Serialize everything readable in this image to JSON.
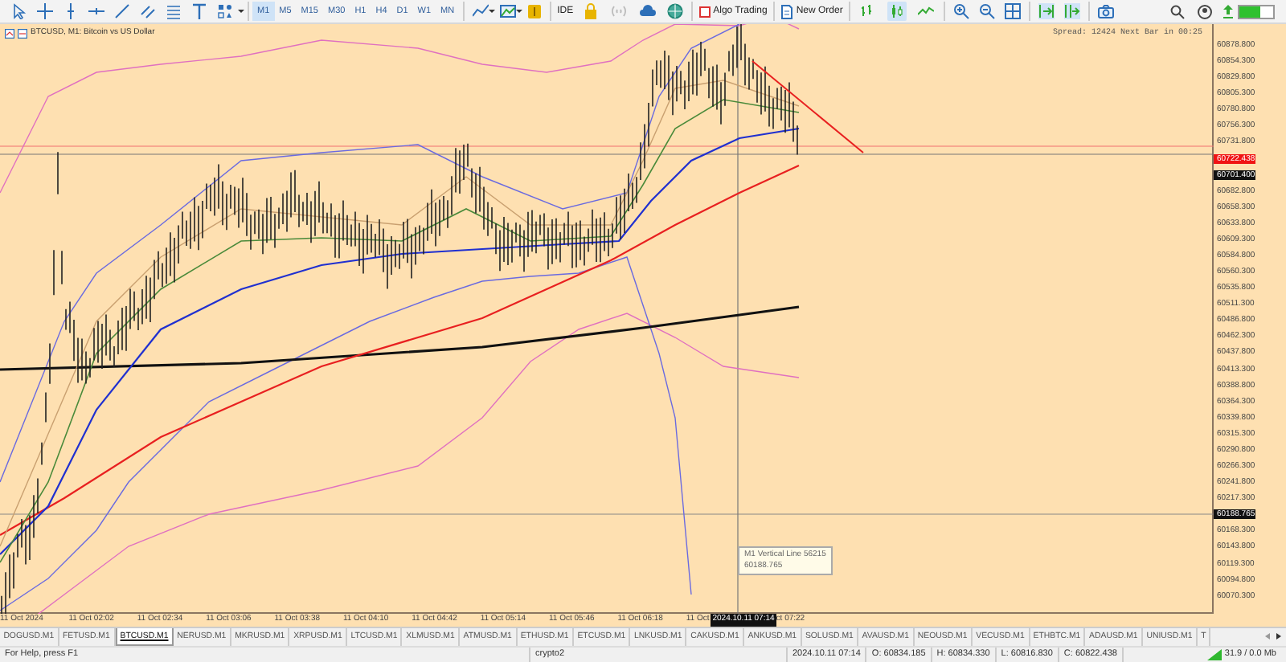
{
  "toolbar": {
    "timeframes": [
      {
        "label": "M1",
        "selected": true
      },
      {
        "label": "M5",
        "selected": false
      },
      {
        "label": "M15",
        "selected": false
      },
      {
        "label": "M30",
        "selected": false
      },
      {
        "label": "H1",
        "selected": false
      },
      {
        "label": "H4",
        "selected": false
      },
      {
        "label": "D1",
        "selected": false
      },
      {
        "label": "W1",
        "selected": false
      },
      {
        "label": "MN",
        "selected": false
      }
    ],
    "ide": "IDE",
    "algo_trading": "Algo Trading",
    "new_order": "New Order",
    "chart_modes": [
      {
        "kind": "bars",
        "selected": false
      },
      {
        "kind": "candles",
        "selected": true
      },
      {
        "kind": "line",
        "selected": false
      }
    ]
  },
  "chart": {
    "title": "BTCUSD, M1:  Bitcoin vs US Dollar",
    "spread_info": "Spread: 12424 Next Bar in 00:25",
    "tooltip": [
      "M1 Vertical Line 56215",
      "60188.765"
    ],
    "price_axis": [
      {
        "label": "60878.800",
        "kind": "tick"
      },
      {
        "label": "60854.300",
        "kind": "tick"
      },
      {
        "label": "60829.800",
        "kind": "tick"
      },
      {
        "label": "60805.300",
        "kind": "tick"
      },
      {
        "label": "60780.800",
        "kind": "tick"
      },
      {
        "label": "60756.300",
        "kind": "tick"
      },
      {
        "label": "60731.800",
        "kind": "tick"
      },
      {
        "label": "60722.438",
        "kind": "bid"
      },
      {
        "label": "60701.400",
        "kind": "marker"
      },
      {
        "label": "60682.800",
        "kind": "tick"
      },
      {
        "label": "60658.300",
        "kind": "tick"
      },
      {
        "label": "60633.800",
        "kind": "tick"
      },
      {
        "label": "60609.300",
        "kind": "tick"
      },
      {
        "label": "60584.800",
        "kind": "tick"
      },
      {
        "label": "60560.300",
        "kind": "tick"
      },
      {
        "label": "60535.800",
        "kind": "tick"
      },
      {
        "label": "60511.300",
        "kind": "tick"
      },
      {
        "label": "60486.800",
        "kind": "tick"
      },
      {
        "label": "60462.300",
        "kind": "tick"
      },
      {
        "label": "60437.800",
        "kind": "tick"
      },
      {
        "label": "60413.300",
        "kind": "tick"
      },
      {
        "label": "60388.800",
        "kind": "tick"
      },
      {
        "label": "60364.300",
        "kind": "tick"
      },
      {
        "label": "60339.800",
        "kind": "tick"
      },
      {
        "label": "60315.300",
        "kind": "tick"
      },
      {
        "label": "60290.800",
        "kind": "tick"
      },
      {
        "label": "60266.300",
        "kind": "tick"
      },
      {
        "label": "60241.800",
        "kind": "tick"
      },
      {
        "label": "60217.300",
        "kind": "tick"
      },
      {
        "label": "60188.765",
        "kind": "marker"
      },
      {
        "label": "60168.300",
        "kind": "tick"
      },
      {
        "label": "60143.800",
        "kind": "tick"
      },
      {
        "label": "60119.300",
        "kind": "tick"
      },
      {
        "label": "60094.800",
        "kind": "tick"
      },
      {
        "label": "60070.300",
        "kind": "tick"
      }
    ],
    "time_axis": [
      {
        "label": "11 Oct 2024",
        "kind": "tick"
      },
      {
        "label": "11 Oct 02:02",
        "kind": "tick"
      },
      {
        "label": "11 Oct 02:34",
        "kind": "tick"
      },
      {
        "label": "11 Oct 03:06",
        "kind": "tick"
      },
      {
        "label": "11 Oct 03:38",
        "kind": "tick"
      },
      {
        "label": "11 Oct 04:10",
        "kind": "tick"
      },
      {
        "label": "11 Oct 04:42",
        "kind": "tick"
      },
      {
        "label": "11 Oct 05:14",
        "kind": "tick"
      },
      {
        "label": "11 Oct 05:46",
        "kind": "tick"
      },
      {
        "label": "11 Oct 06:18",
        "kind": "tick"
      },
      {
        "label": "11 Oct",
        "kind": "partial"
      },
      {
        "label": "2024.10.11 07:14",
        "kind": "marker"
      },
      {
        "label": "ct 07:22",
        "kind": "partial"
      }
    ]
  },
  "tabs": [
    {
      "label": "DOGUSD.M1",
      "selected": false
    },
    {
      "label": "FETUSD.M1",
      "selected": false
    },
    {
      "label": "BTCUSD.M1",
      "selected": true
    },
    {
      "label": "NERUSD.M1",
      "selected": false
    },
    {
      "label": "MKRUSD.M1",
      "selected": false
    },
    {
      "label": "XRPUSD.M1",
      "selected": false
    },
    {
      "label": "LTCUSD.M1",
      "selected": false
    },
    {
      "label": "XLMUSD.M1",
      "selected": false
    },
    {
      "label": "ATMUSD.M1",
      "selected": false
    },
    {
      "label": "ETHUSD.M1",
      "selected": false
    },
    {
      "label": "ETCUSD.M1",
      "selected": false
    },
    {
      "label": "LNKUSD.M1",
      "selected": false
    },
    {
      "label": "CAKUSD.M1",
      "selected": false
    },
    {
      "label": "ANKUSD.M1",
      "selected": false
    },
    {
      "label": "SOLUSD.M1",
      "selected": false
    },
    {
      "label": "AVAUSD.M1",
      "selected": false
    },
    {
      "label": "NEOUSD.M1",
      "selected": false
    },
    {
      "label": "VECUSD.M1",
      "selected": false
    },
    {
      "label": "ETHBTC.M1",
      "selected": false
    },
    {
      "label": "ADAUSD.M1",
      "selected": false
    },
    {
      "label": "UNIUSD.M1",
      "selected": false
    },
    {
      "label": "T",
      "selected": false
    }
  ],
  "status_bar": {
    "help": "For Help, press F1",
    "profile": "crypto2",
    "time": "2024.10.11 07:14",
    "open": "O: 60834.185",
    "high": "H: 60834.330",
    "low": "L: 60816.830",
    "close": "C: 60822.438",
    "traffic": "31.9 / 0.0 Mb"
  }
}
